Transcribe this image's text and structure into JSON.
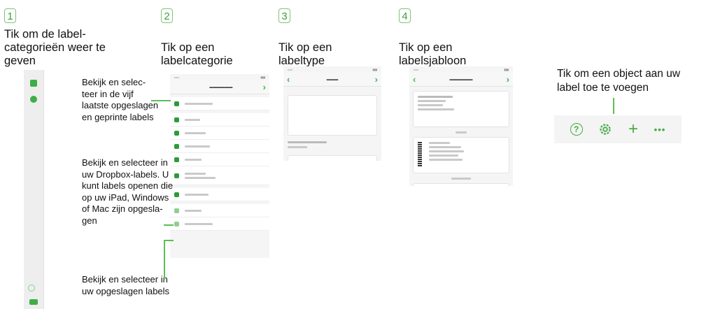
{
  "steps": [
    {
      "number": "1",
      "title": "Tik om de label-categorieën weer te geven"
    },
    {
      "number": "2",
      "title": "Tik op een labelcategorie"
    },
    {
      "number": "3",
      "title": "Tik op een labeltype"
    },
    {
      "number": "4",
      "title": "Tik op een labelsjabloon"
    }
  ],
  "callouts": {
    "recent": "Bekijk en selec-teer in de vijf laatste opgeslagen en geprinte labels",
    "dropbox": "Bekijk en selecteer in uw Dropbox-labels. U kunt labels openen die op uw iPad, Windows of Mac zijn opgesla-gen",
    "saved": "Bekijk en selecteer in uw opgeslagen labels",
    "add_object": "Tik om een object aan uw label toe te voegen"
  },
  "toolbar": {
    "help_label": "?",
    "add_label": "+",
    "more_label": "•••"
  },
  "icons": [
    "help-icon",
    "settings-icon",
    "plus-icon",
    "more-icon",
    "chevron-left-icon",
    "chevron-right-icon"
  ],
  "colors": {
    "accent": "#4aaa46",
    "callout_line": "#5bbf58",
    "step_border": "#7cc576"
  }
}
